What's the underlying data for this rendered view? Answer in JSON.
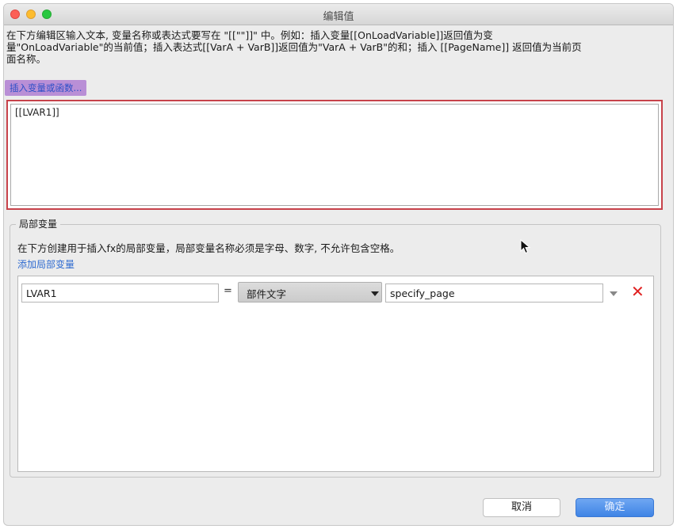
{
  "window": {
    "title": "编辑值"
  },
  "description": {
    "line1": "在下方编辑区输入文本, 变量名称或表达式要写在 \"[[\"\"]]\" 中。例如：插入变量[[OnLoadVariable]]返回值为变",
    "line2": "量\"OnLoadVariable\"的当前值；插入表达式[[VarA + VarB]]返回值为\"VarA + VarB\"的和；插入 [[PageName]] 返回值为当前页",
    "line3": "面名称。"
  },
  "insert_button": {
    "label": "插入变量或函数..."
  },
  "editor": {
    "content": "[[LVAR1]]"
  },
  "local_vars": {
    "legend": "局部变量",
    "description": "在下方创建用于插入fx的局部变量，局部变量名称必须是字母、数字, 不允许包含空格。",
    "add_link": "添加局部变量",
    "rows": [
      {
        "name": "LVAR1",
        "equals": "=",
        "type": "部件文字",
        "value": "specify_page"
      }
    ]
  },
  "buttons": {
    "cancel": "取消",
    "ok": "确定"
  },
  "colors": {
    "editor_border": "#c7424a",
    "insert_button_bg": "#b98fd6",
    "link": "#2f6bd0",
    "delete": "#e02020",
    "ok_button": "#3f84e5"
  },
  "icons": {
    "delete": "close-x-icon",
    "dropdown": "chevron-down-icon"
  }
}
